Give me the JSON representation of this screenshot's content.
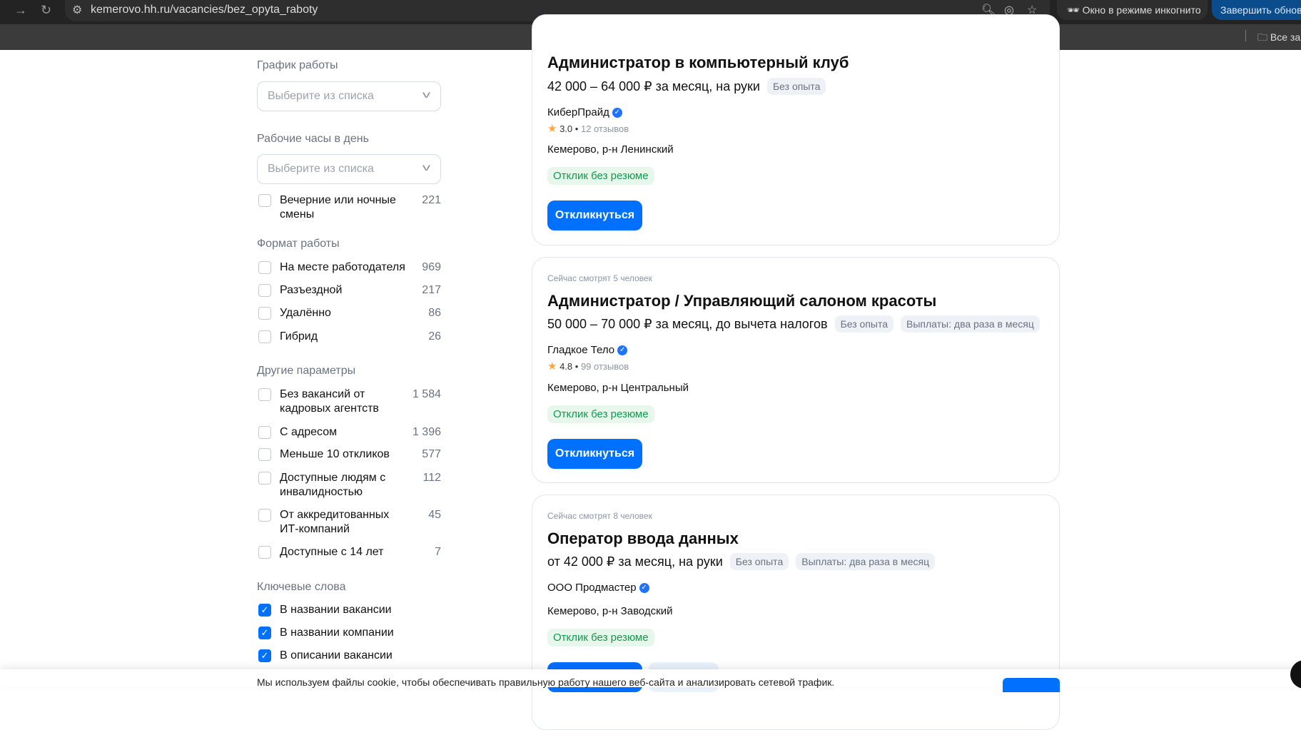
{
  "browser": {
    "url": "kemerovo.hh.ru/vacancies/bez_opyta_raboty",
    "incognito_label": "Окно в режиме инкогнито",
    "finish_label": "Завершить обновл",
    "bookmarks_label": "Все за"
  },
  "filters": {
    "schedule": {
      "label": "График работы",
      "placeholder": "Выберите из списка"
    },
    "hours": {
      "label": "Рабочие часы в день",
      "placeholder": "Выберите из списка",
      "option": {
        "label": "Вечерние или ночные смены",
        "count": "221"
      }
    },
    "format": {
      "label": "Формат работы",
      "items": [
        {
          "label": "На месте работодателя",
          "count": "969"
        },
        {
          "label": "Разъездной",
          "count": "217"
        },
        {
          "label": "Удалённо",
          "count": "86"
        },
        {
          "label": "Гибрид",
          "count": "26"
        }
      ]
    },
    "other": {
      "label": "Другие параметры",
      "items": [
        {
          "label": "Без вакансий от кадровых агентств",
          "count": "1 584"
        },
        {
          "label": "С адресом",
          "count": "1 396"
        },
        {
          "label": "Меньше 10 откликов",
          "count": "577"
        },
        {
          "label": "Доступные людям с инвалидностью",
          "count": "112"
        },
        {
          "label": "От аккредитованных ИТ-компаний",
          "count": "45"
        },
        {
          "label": "Доступные с 14 лет",
          "count": "7"
        }
      ]
    },
    "keywords": {
      "label": "Ключевые слова",
      "items": [
        {
          "label": "В названии вакансии",
          "checked": true
        },
        {
          "label": "В названии компании",
          "checked": true
        },
        {
          "label": "В описании вакансии",
          "checked": true
        }
      ]
    }
  },
  "vacancies": [
    {
      "title": "Администратор в компьютерный клуб",
      "salary": "42 000 – 64 000 ₽ за месяц, на руки",
      "chips": [
        "Без опыта"
      ],
      "company": "КиберПрайд",
      "rating": "3.0",
      "reviews": "12 отзывов",
      "location": "Кемерово, р-н Ленинский",
      "tag": "Отклик без резюме",
      "button": "Откликнуться"
    },
    {
      "watching": "Сейчас смотрят 5 человек",
      "title": "Администратор / Управляющий салоном красоты",
      "salary": "50 000 – 70 000 ₽ за месяц, до вычета налогов",
      "chips": [
        "Без опыта",
        "Выплаты: два раза в месяц"
      ],
      "company": "Гладкое Тело",
      "rating": "4.8",
      "reviews": "99 отзывов",
      "location": "Кемерово, р-н Центральный",
      "tag": "Отклик без резюме",
      "button": "Откликнуться"
    },
    {
      "watching": "Сейчас смотрят 8 человек",
      "title": "Оператор ввода данных",
      "salary": "от 42 000 ₽ за месяц, на руки",
      "chips": [
        "Без опыта",
        "Выплаты: два раза в месяц"
      ],
      "company": "ООО Продмастер",
      "location": "Кемерово, р-н Заводский",
      "tag": "Отклик без резюме"
    }
  ],
  "cookie": {
    "text": "Мы используем файлы cookie, чтобы обеспечивать правильную работу нашего веб-сайта и анализировать сетевой трафик."
  }
}
